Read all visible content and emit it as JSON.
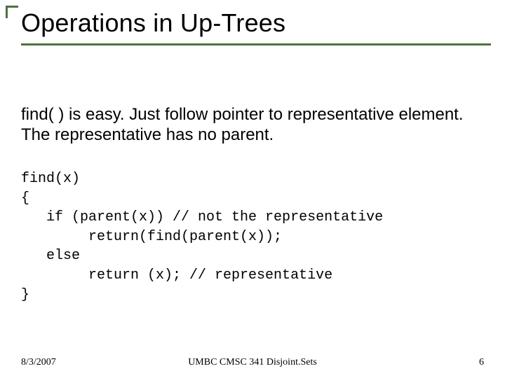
{
  "title": "Operations in Up-Trees",
  "body": "find( ) is easy. Just follow pointer to representative element. The representative has no parent.",
  "code": "find(x)\n{\n   if (parent(x)) // not the representative\n        return(find(parent(x));\n   else\n        return (x); // representative\n}",
  "footer": {
    "date": "8/3/2007",
    "center": "UMBC CMSC 341 Disjoint.Sets",
    "page": "6"
  }
}
